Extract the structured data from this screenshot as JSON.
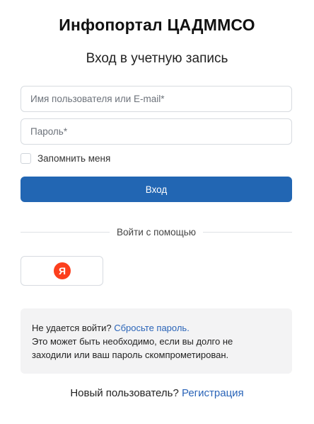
{
  "header": {
    "title": "Инфопортал ЦАДММСО",
    "subtitle": "Вход в учетную запись"
  },
  "form": {
    "username_placeholder": "Имя пользователя или E-mail*",
    "username_value": "",
    "password_placeholder": "Пароль*",
    "password_value": "",
    "remember_label": "Запомнить меня",
    "remember_checked": false,
    "submit_label": "Вход"
  },
  "social": {
    "divider_label": "Войти с помощью",
    "providers": [
      {
        "name": "Яндекс",
        "icon": "yandex-icon",
        "glyph": "Я",
        "color": "#fc3f1d"
      }
    ]
  },
  "help": {
    "question": "Не удается войти?",
    "reset_link": "Сбросьте пароль.",
    "line2": "Это может быть необходимо, если вы долго не",
    "line3": "заходили или ваш пароль скомпрометирован."
  },
  "register": {
    "prompt": "Новый пользователь?",
    "link": "Регистрация"
  },
  "colors": {
    "primary": "#2266b3",
    "link": "#2a64b8",
    "info_background": "#f3f3f4",
    "yandex": "#fc3f1d"
  }
}
